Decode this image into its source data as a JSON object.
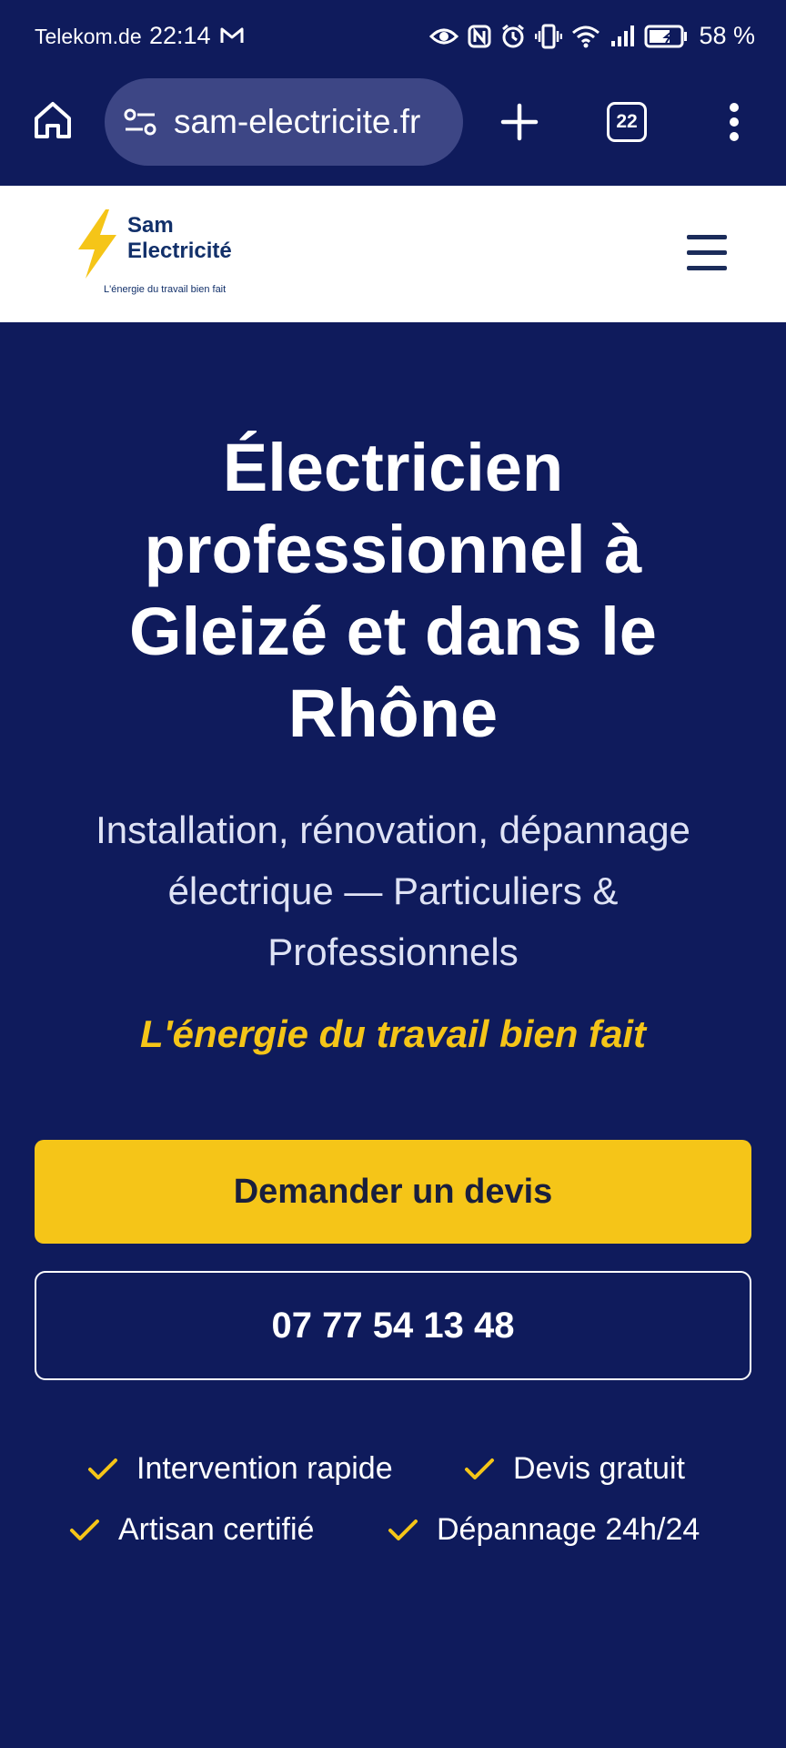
{
  "status_bar": {
    "carrier": "Telekom.de",
    "time": "22:14",
    "battery": "58 %"
  },
  "browser": {
    "url": "sam-electricite.fr",
    "tab_count": "22"
  },
  "header": {
    "logo_line1": "Sam",
    "logo_line2": "Electricité",
    "logo_tagline": "L'énergie du travail bien fait"
  },
  "hero": {
    "title": "Électricien professionnel à Gleizé et dans le Rhône",
    "subtitle": "Installation, rénovation, dépannage électrique — Particuliers & Professionnels",
    "tagline": "L'énergie du travail bien fait",
    "cta_quote": "Demander un devis",
    "cta_phone": "07 77 54 13 48",
    "features": [
      "Intervention rapide",
      "Devis gratuit",
      "Artisan certifié",
      "Dépannage 24h/24"
    ]
  },
  "colors": {
    "navy": "#0f1b5c",
    "accent_yellow": "#f5c518",
    "url_pill": "#3d4685",
    "logo_blue": "#12306a"
  },
  "icons": {
    "status": [
      "mail-icon",
      "eye-icon",
      "nfc-icon",
      "alarm-icon",
      "vibrate-icon",
      "wifi-icon",
      "signal-icon",
      "battery-icon"
    ],
    "browser": [
      "home-icon",
      "tune-icon",
      "plus-icon",
      "tabs-icon",
      "more-vert-icon"
    ],
    "header": [
      "bolt-icon",
      "hamburger-icon"
    ],
    "features": "check-icon"
  }
}
